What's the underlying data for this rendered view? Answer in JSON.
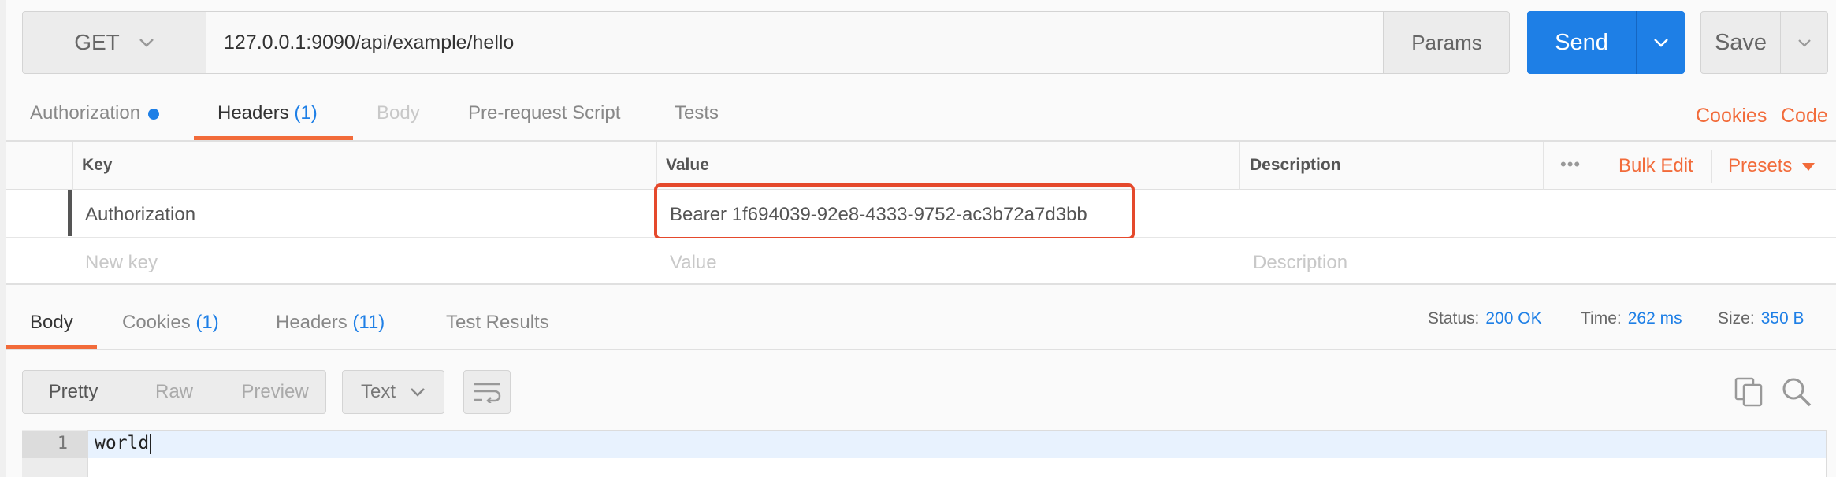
{
  "request": {
    "method": "GET",
    "url": "127.0.0.1:9090/api/example/hello",
    "params_label": "Params",
    "send_label": "Send",
    "save_label": "Save"
  },
  "request_tabs": {
    "authorization": "Authorization",
    "headers": "Headers",
    "headers_count": "(1)",
    "body": "Body",
    "prerequest": "Pre-request Script",
    "tests": "Tests"
  },
  "request_links": {
    "cookies": "Cookies",
    "code": "Code"
  },
  "headers_table": {
    "col_key": "Key",
    "col_value": "Value",
    "col_description": "Description",
    "more": "•••",
    "bulk_edit": "Bulk Edit",
    "presets": "Presets",
    "rows": [
      {
        "key": "Authorization",
        "value": "Bearer 1f694039-92e8-4333-9752-ac3b72a7d3bb",
        "description": ""
      }
    ],
    "new_row": {
      "key_placeholder": "New key",
      "value_placeholder": "Value",
      "description_placeholder": "Description"
    }
  },
  "response_tabs": {
    "body": "Body",
    "cookies": "Cookies",
    "cookies_count": "(1)",
    "headers": "Headers",
    "headers_count": "(11)",
    "test_results": "Test Results"
  },
  "response_status": {
    "status_label": "Status:",
    "status_value": "200 OK",
    "time_label": "Time:",
    "time_value": "262 ms",
    "size_label": "Size:",
    "size_value": "350 B"
  },
  "body_view": {
    "pretty": "Pretty",
    "raw": "Raw",
    "preview": "Preview",
    "format": "Text",
    "line_number": "1",
    "content": "world"
  },
  "colors": {
    "accent": "#1e7fe6",
    "tab_active": "#f26b3a",
    "highlight_box": "#e5492c"
  }
}
